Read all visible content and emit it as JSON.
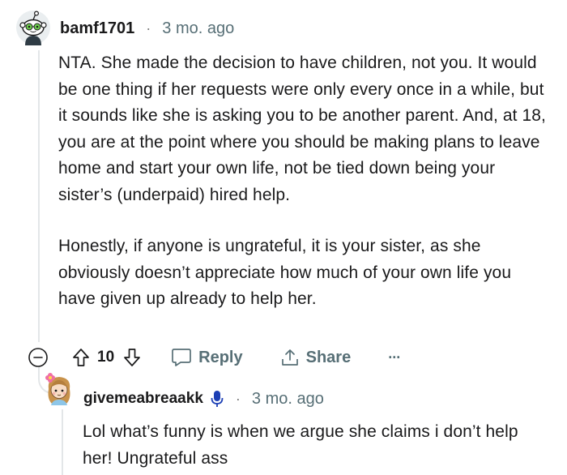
{
  "comment": {
    "username": "bamf1701",
    "separator": "·",
    "timestamp": "3 mo. ago",
    "paragraph1": "NTA. She made the decision to have children, not you. It would be one thing if her requests were only every once in a while, but it sounds like she is asking you to be another parent. And, at 18, you are at the point where you should be making plans to leave home and start your own life, not be tied down being your sister’s (underpaid) hired help.",
    "paragraph2": "Honestly, if anyone is ungrateful, it is your sister, as she obviously doesn’t appreciate how much of your own life you have given up already to help her.",
    "vote_count": "10",
    "reply_label": "Reply",
    "share_label": "Share",
    "more_label": "···"
  },
  "reply": {
    "username": "givemeabreaakk",
    "separator": "·",
    "timestamp": "3 mo. ago",
    "text": "Lol what’s funny is when we argue she claims i don’t help her! Ungrateful ass"
  },
  "colors": {
    "text": "#1a1a1b",
    "meta": "#576f76",
    "thread": "#e3e6e8",
    "op_badge": "#1c3fb5"
  },
  "icons": {
    "collapse": "minus-circle-icon",
    "upvote": "arrow-up-icon",
    "downvote": "arrow-down-icon",
    "reply": "speech-bubble-icon",
    "share": "share-icon",
    "more": "ellipsis-icon",
    "op": "microphone-icon"
  }
}
